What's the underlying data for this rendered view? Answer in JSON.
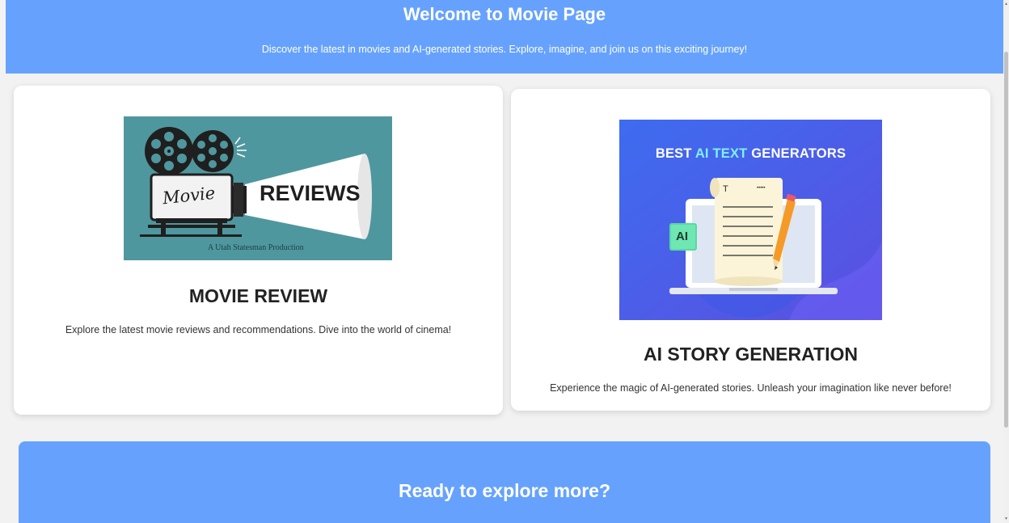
{
  "hero": {
    "title": "Welcome to Movie Page",
    "subtitle": "Discover the latest in movies and AI-generated stories. Explore, imagine, and join us on this exciting journey!",
    "background": "#66a2fd"
  },
  "cards": [
    {
      "title": "MOVIE REVIEW",
      "description": "Explore the latest movie reviews and recommendations. Dive into the world of cinema!",
      "image": {
        "word_script": "Movie",
        "word_bold": "REVIEWS",
        "caption": "A Utah Statesman Production",
        "background": "#4f979e"
      }
    },
    {
      "title": "AI STORY GENERATION",
      "description": "Experience the magic of AI-generated stories. Unleash your imagination like never before!",
      "image": {
        "headline_start": "BEST ",
        "headline_accent": "AI TEXT",
        "headline_end": " GENERATORS",
        "badge": "AI",
        "doc_letter": "T",
        "doc_dots": "•••••"
      }
    }
  ],
  "cta": {
    "title": "Ready to explore more?"
  },
  "colors": {
    "accent": "#66a2fd",
    "card_bg": "#ffffff",
    "page_bg": "#f2f2f2"
  }
}
